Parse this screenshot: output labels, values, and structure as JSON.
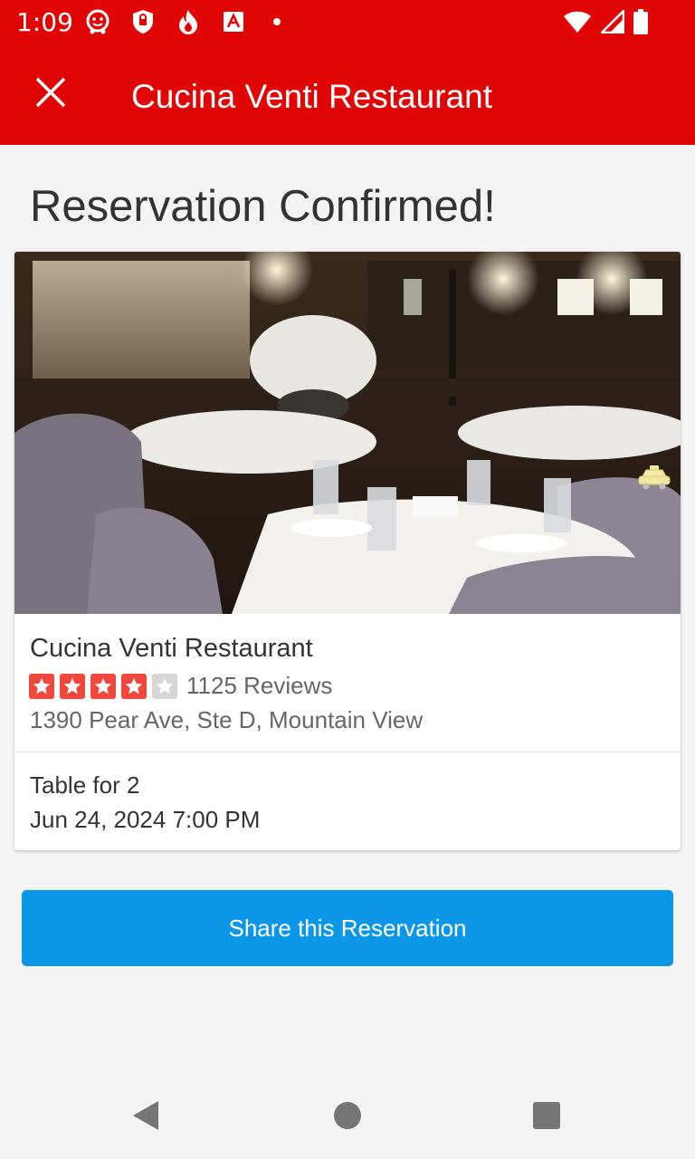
{
  "status_bar": {
    "time": "1:09",
    "icons": [
      "waze-icon",
      "shield-icon",
      "fire-icon",
      "app-a-icon",
      "notification-dot-icon",
      "wifi-icon",
      "signal-icon",
      "battery-icon"
    ]
  },
  "app_bar": {
    "title": "Cucina Venti Restaurant",
    "close_icon": "close-icon",
    "color": "#e00606"
  },
  "confirmation": {
    "heading": "Reservation Confirmed!"
  },
  "restaurant": {
    "name": "Cucina Venti Restaurant",
    "rating": 4,
    "rating_max": 5,
    "reviews": "1125 Reviews",
    "address": "1390 Pear Ave, Ste D, Mountain View",
    "photo": "restaurant-dining-room-photo"
  },
  "reservation": {
    "party": "Table for 2",
    "datetime": "Jun 24, 2024 7:00 PM"
  },
  "actions": {
    "share_label": "Share this Reservation",
    "share_color": "#0c96e8"
  },
  "nav_bar": {
    "icons": [
      "back-icon",
      "home-icon",
      "recents-icon"
    ]
  }
}
